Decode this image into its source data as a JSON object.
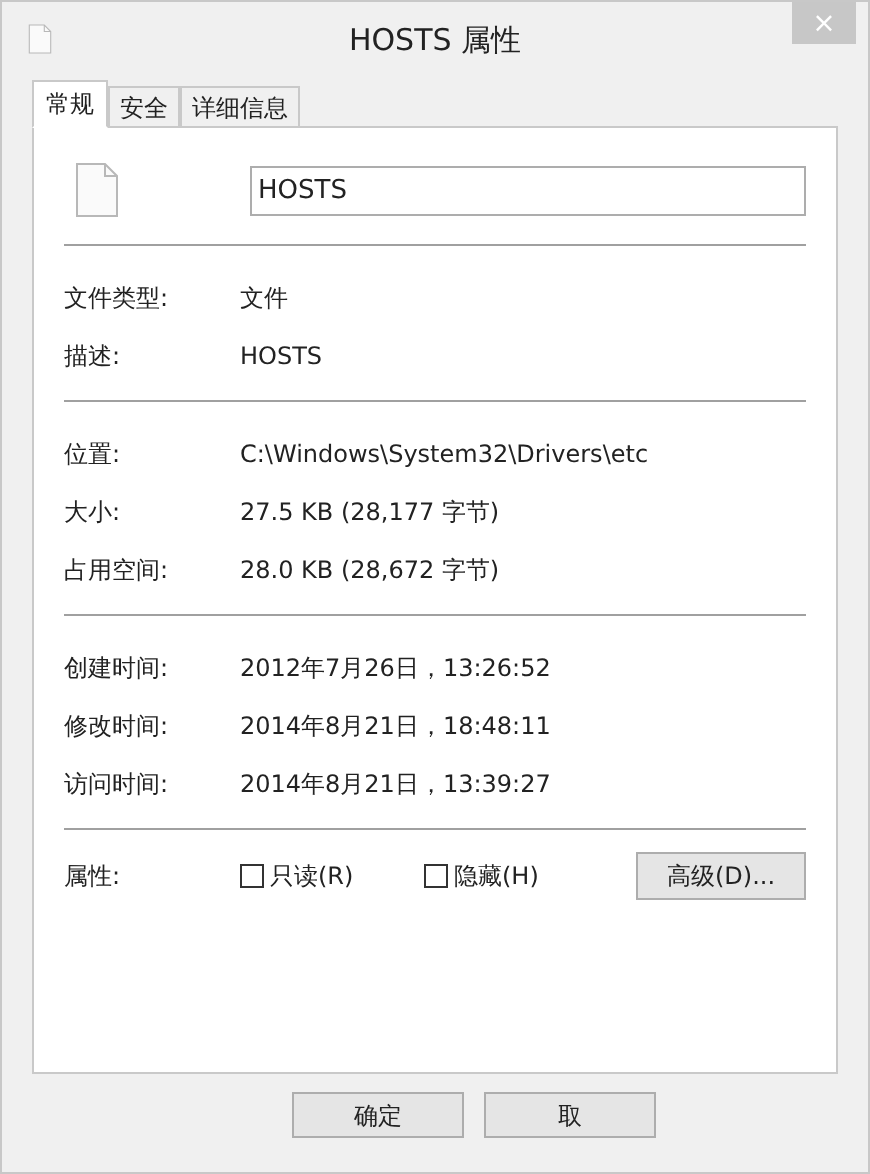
{
  "window": {
    "title": "HOSTS 属性",
    "close": "×"
  },
  "tabs": [
    {
      "label": "常规",
      "selected": true
    },
    {
      "label": "安全",
      "selected": false
    },
    {
      "label": "详细信息",
      "selected": false
    }
  ],
  "name_field": {
    "value": "HOSTS"
  },
  "groups": [
    [
      {
        "label": "文件类型:",
        "value": "文件"
      },
      {
        "label": "描述:",
        "value": "HOSTS"
      }
    ],
    [
      {
        "label": "位置:",
        "value": "C:\\Windows\\System32\\Drivers\\etc"
      },
      {
        "label": "大小:",
        "value": "27.5 KB (28,177 字节)"
      },
      {
        "label": "占用空间:",
        "value": "28.0 KB (28,672 字节)"
      }
    ],
    [
      {
        "label": "创建时间:",
        "value": "2012年7月26日，13:26:52"
      },
      {
        "label": "修改时间:",
        "value": "2014年8月21日，18:48:11"
      },
      {
        "label": "访问时间:",
        "value": "2014年8月21日，13:39:27"
      }
    ]
  ],
  "attributes": {
    "label": "属性:",
    "options": [
      {
        "label": "只读(R)",
        "checked": false
      },
      {
        "label": "隐藏(H)",
        "checked": false
      }
    ],
    "advanced": "高级(D)..."
  },
  "buttons": [
    "确定",
    "取"
  ]
}
